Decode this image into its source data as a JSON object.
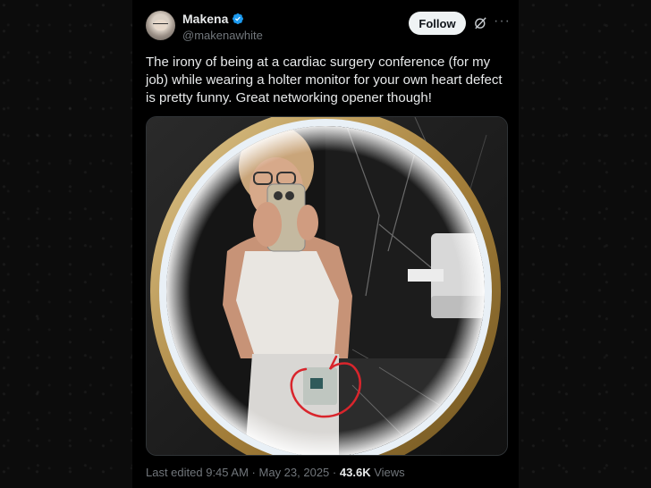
{
  "user": {
    "display_name": "Makena",
    "handle": "@makenawhite",
    "verified": true
  },
  "follow_button": {
    "label": "Follow"
  },
  "more_label": "···",
  "tweet": {
    "text": "The irony of being at a cardiac surgery conference (for my job) while wearing a holter monitor for your own heart defect is pretty funny. Great networking opener though!"
  },
  "meta": {
    "edited_time": "Last edited 9:45 AM",
    "separator": "·",
    "date": "May 23, 2025",
    "views_count": "43.6K",
    "views_label": "Views"
  },
  "colors": {
    "background": "#000000",
    "verified_badge": "#1d9bf0",
    "follow_button_bg": "#eff3f4",
    "annotation_circle": "#d9252c",
    "mirror_frame": "#b8944e"
  },
  "icons": [
    "verified-badge-icon",
    "grok-icon",
    "more-icon"
  ]
}
